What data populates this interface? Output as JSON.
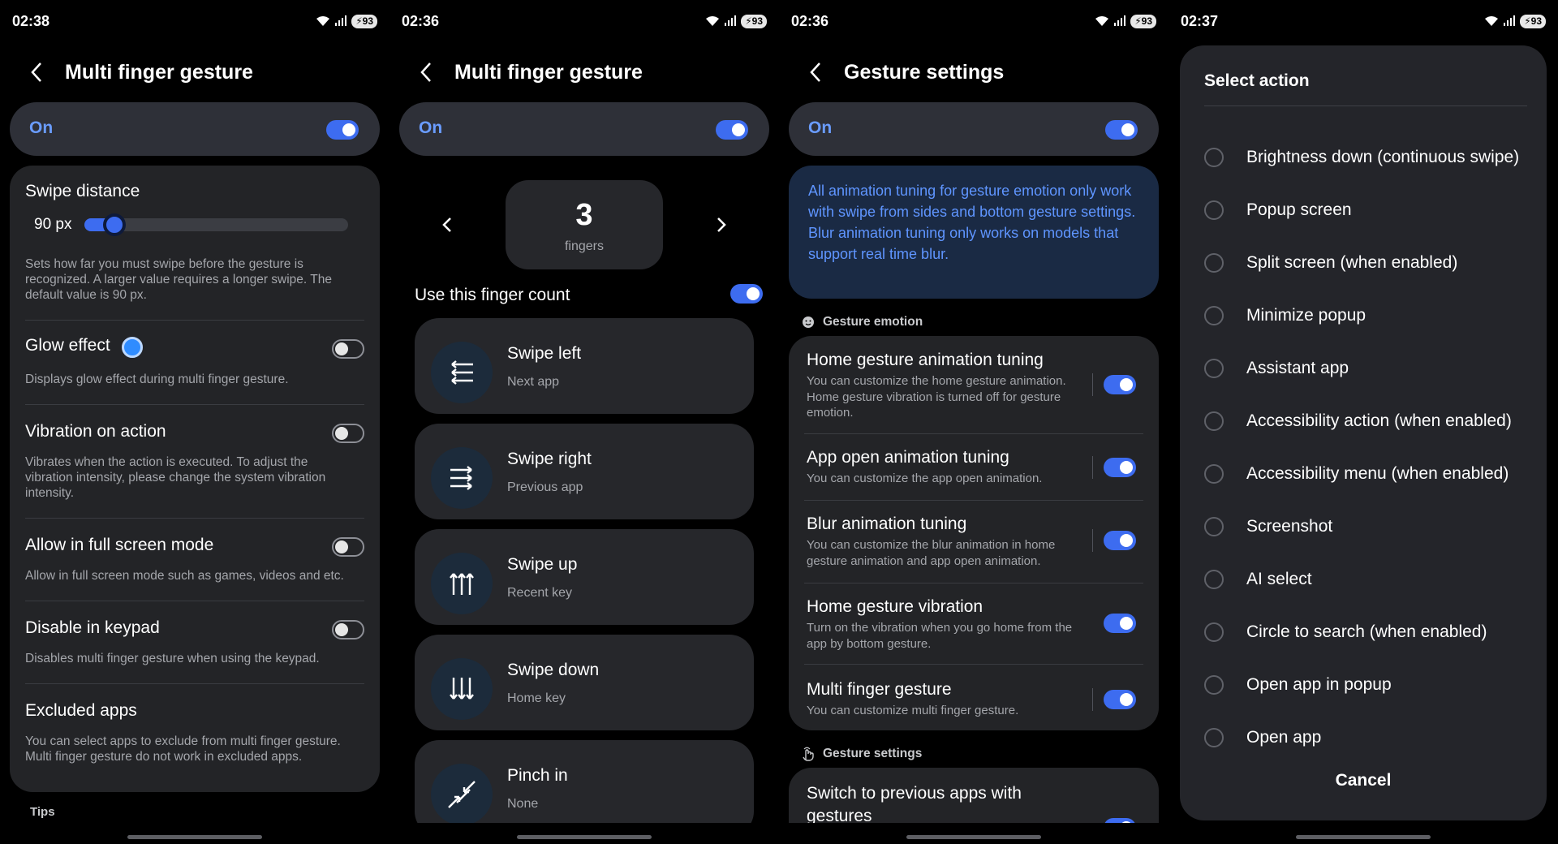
{
  "status": {
    "p1_time": "02:38",
    "p2_time": "02:36",
    "p3_time": "02:36",
    "p4_time": "02:37",
    "battery": "93"
  },
  "colors": {
    "accent": "#3d6cf0",
    "accent_text": "#6a9cff",
    "card": "#232427",
    "background": "#000000"
  },
  "panel1": {
    "title": "Multi finger gesture",
    "master_label": "On",
    "swipe_distance": {
      "title": "Swipe distance",
      "value": "90 px",
      "level": 0.1,
      "desc": "Sets how far you must swipe before the gesture is recognized. A larger value requires a longer swipe. The default value is 90 px."
    },
    "glow_effect": {
      "title": "Glow effect",
      "desc": "Displays glow effect during multi finger gesture.",
      "enabled": false
    },
    "vibration": {
      "title": "Vibration on action",
      "desc": "Vibrates when the action is executed. To adjust the vibration intensity, please change the system vibration intensity.",
      "enabled": false
    },
    "full_screen": {
      "title": "Allow in full screen mode",
      "desc": "Allow in full screen mode such as games, videos and etc.",
      "enabled": false
    },
    "keypad": {
      "title": "Disable in keypad",
      "desc": "Disables multi finger gesture when using the keypad.",
      "enabled": false
    },
    "excluded": {
      "title": "Excluded apps",
      "desc": "You can select apps to exclude from multi finger gesture. Multi finger gesture do not work in excluded apps."
    },
    "tips": "Tips"
  },
  "panel2": {
    "title": "Multi finger gesture",
    "master_label": "On",
    "finger_count": "3",
    "finger_label": "fingers",
    "use_count_label": "Use this finger count",
    "gestures": [
      {
        "title": "Swipe left",
        "action": "Next app",
        "icon": "swipe-left-icon"
      },
      {
        "title": "Swipe right",
        "action": "Previous app",
        "icon": "swipe-right-icon"
      },
      {
        "title": "Swipe up",
        "action": "Recent key",
        "icon": "swipe-up-icon"
      },
      {
        "title": "Swipe down",
        "action": "Home key",
        "icon": "swipe-down-icon"
      },
      {
        "title": "Pinch in",
        "action": "None",
        "icon": "pinch-in-icon"
      }
    ]
  },
  "panel3": {
    "title": "Gesture settings",
    "master_label": "On",
    "notice_1": "All animation tuning for gesture emotion only work with swipe from sides and bottom gesture settings.",
    "notice_2": "Blur animation tuning only works on models that support real time blur.",
    "section_emotion": "Gesture emotion",
    "items": [
      {
        "title": "Home gesture animation tuning",
        "desc": "You can customize the home gesture animation. Home gesture vibration is turned off for gesture emotion."
      },
      {
        "title": "App open animation tuning",
        "desc": "You can customize the app open animation."
      },
      {
        "title": "Blur animation tuning",
        "desc": "You can customize the blur animation in home gesture animation and app open animation."
      },
      {
        "title": "Home gesture vibration",
        "desc": "Turn on the vibration when you go home from the app by bottom gesture."
      },
      {
        "title": "Multi finger gesture",
        "desc": "You can customize multi finger gesture."
      }
    ],
    "section_settings": "Gesture settings",
    "switch_prev": "Switch to previous apps with gestures"
  },
  "panel4": {
    "title": "Select action",
    "options": [
      "Brightness down (continuous swipe)",
      "Popup screen",
      "Split screen (when enabled)",
      "Minimize popup",
      "Assistant app",
      "Accessibility action (when enabled)",
      "Accessibility menu (when enabled)",
      "Screenshot",
      "AI select",
      "Circle to search (when enabled)",
      "Open app in popup",
      "Open app"
    ],
    "cancel": "Cancel"
  }
}
